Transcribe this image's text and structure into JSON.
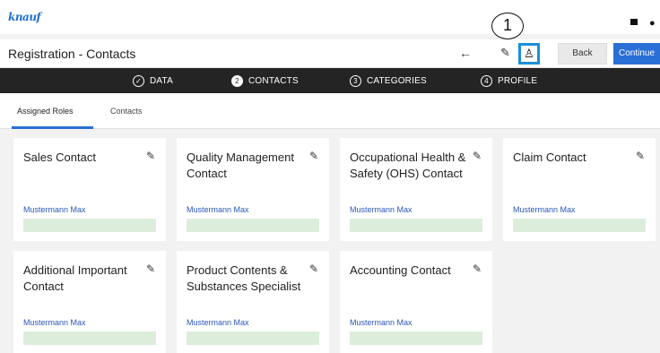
{
  "app": {
    "logo_text": "knauf"
  },
  "callout": {
    "number": "1"
  },
  "header": {
    "title": "Registration - Contacts",
    "back_label": "Back",
    "continue_label": "Continue",
    "accent": "#2a6fd6",
    "highlight": "#1a8fd8"
  },
  "steps": [
    {
      "icon": "check-circle-icon",
      "label": "DATA",
      "marker": "✓"
    },
    {
      "icon": "number-circle-icon",
      "label": "CONTACTS",
      "marker": "2"
    },
    {
      "icon": "number-circle-icon",
      "label": "CATEGORIES",
      "marker": "3"
    },
    {
      "icon": "number-circle-icon",
      "label": "PROFILE",
      "marker": "4"
    }
  ],
  "tabs": [
    {
      "label": "Assigned Roles",
      "active": true
    },
    {
      "label": "Contacts",
      "active": false
    }
  ],
  "cards": [
    {
      "title": "Sales Contact",
      "person": "Mustermann Max"
    },
    {
      "title": "Quality Management Contact",
      "person": "Mustermann Max"
    },
    {
      "title": "Occupational Health & Safety (OHS) Contact",
      "person": "Mustermann Max"
    },
    {
      "title": "Claim Contact",
      "person": "Mustermann Max"
    },
    {
      "title": "Additional Important Contact",
      "person": "Mustermann Max"
    },
    {
      "title": "Product Contents & Substances Specialist",
      "person": "Mustermann Max"
    },
    {
      "title": "Accounting Contact",
      "person": "Mustermann Max"
    }
  ]
}
